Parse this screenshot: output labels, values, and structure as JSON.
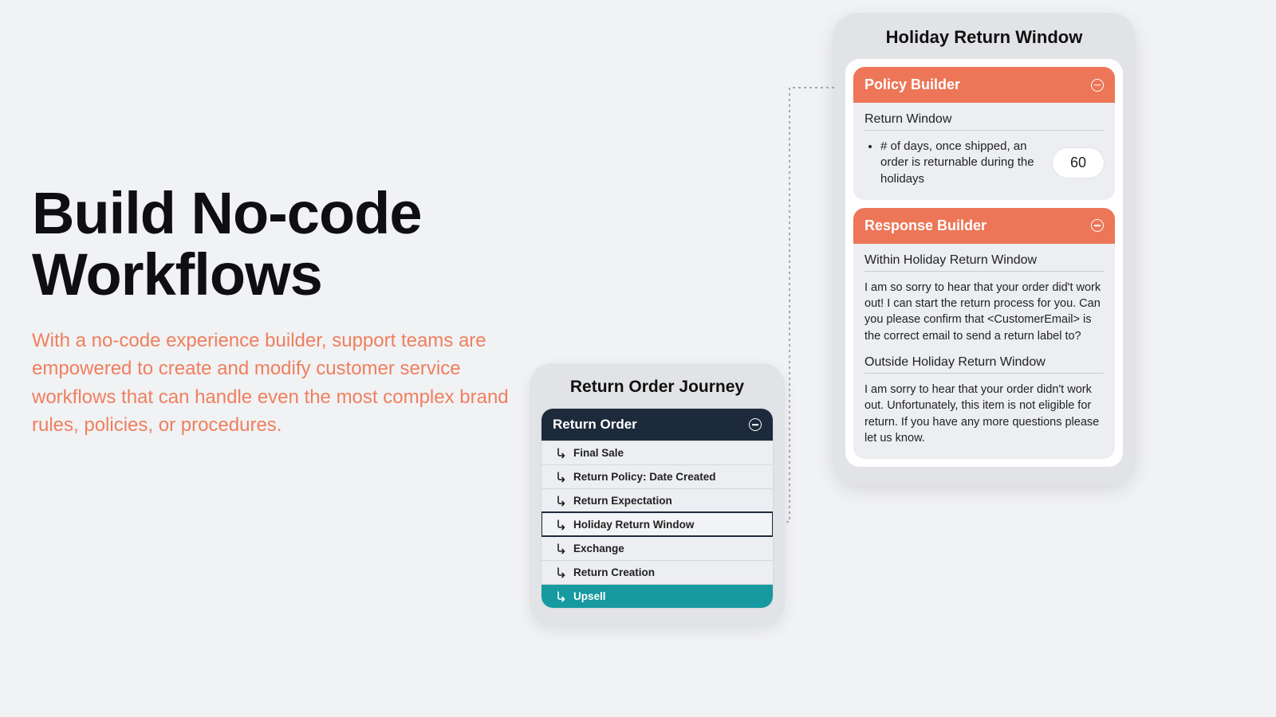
{
  "hero": {
    "title": "Build No-code Workflows",
    "subtitle": "With a no-code experience builder, support teams are empowered to create and modify customer service workflows that can handle even the most complex brand rules, policies, or procedures."
  },
  "journey": {
    "title": "Return Order Journey",
    "header": "Return Order",
    "items": [
      {
        "label": "Final Sale"
      },
      {
        "label": "Return Policy: Date Created"
      },
      {
        "label": "Return Expectation"
      },
      {
        "label": "Holiday Return Window",
        "selected": true
      },
      {
        "label": "Exchange"
      },
      {
        "label": "Return Creation"
      },
      {
        "label": "Upsell",
        "teal": true
      }
    ]
  },
  "detail": {
    "title": "Holiday Return Window",
    "policy": {
      "section_header": "Policy Builder",
      "section_label": "Return Window",
      "rule_text": "# of days, once shipped, an order is returnable during the holidays",
      "value": "60"
    },
    "response": {
      "section_header": "Response Builder",
      "within_label": "Within Holiday Return Window",
      "within_text": "I am so sorry to hear that your order did't work out! I can start the return process for you. Can you please confirm that <CustomerEmail> is the correct email to send a return label to?",
      "outside_label": "Outside Holiday Return Window",
      "outside_text": "I am sorry to hear that your order didn't work out.  Unfortunately, this item is not eligible for return. If you have any more questions please let us know."
    }
  }
}
